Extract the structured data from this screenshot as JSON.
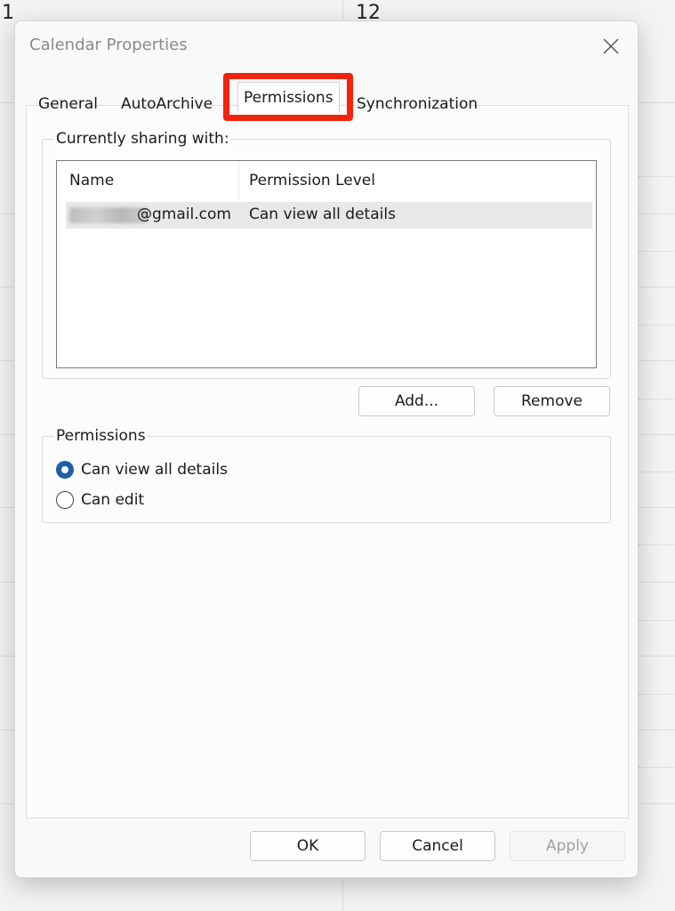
{
  "background": {
    "day_left": "1",
    "day_right": "12"
  },
  "dialog": {
    "title": "Calendar Properties",
    "close_icon": "close-icon"
  },
  "tabs": [
    {
      "label": "General"
    },
    {
      "label": "AutoArchive"
    },
    {
      "label": "Permissions",
      "selected": true
    },
    {
      "label": "Synchronization"
    }
  ],
  "sharing": {
    "group_label": "Currently sharing with:",
    "columns": [
      "Name",
      "Permission Level"
    ],
    "rows": [
      {
        "name": "@gmail.com",
        "level": "Can view all details"
      }
    ]
  },
  "buttons": {
    "add": "Add...",
    "remove": "Remove",
    "ok": "OK",
    "cancel": "Cancel",
    "apply": "Apply"
  },
  "permissions": {
    "group_label": "Permissions",
    "options": [
      {
        "label": "Can view all details",
        "selected": true
      },
      {
        "label": "Can edit",
        "selected": false
      }
    ]
  },
  "colors": {
    "highlight": "#f0240c",
    "radio_accent": "#1f5fa8"
  }
}
